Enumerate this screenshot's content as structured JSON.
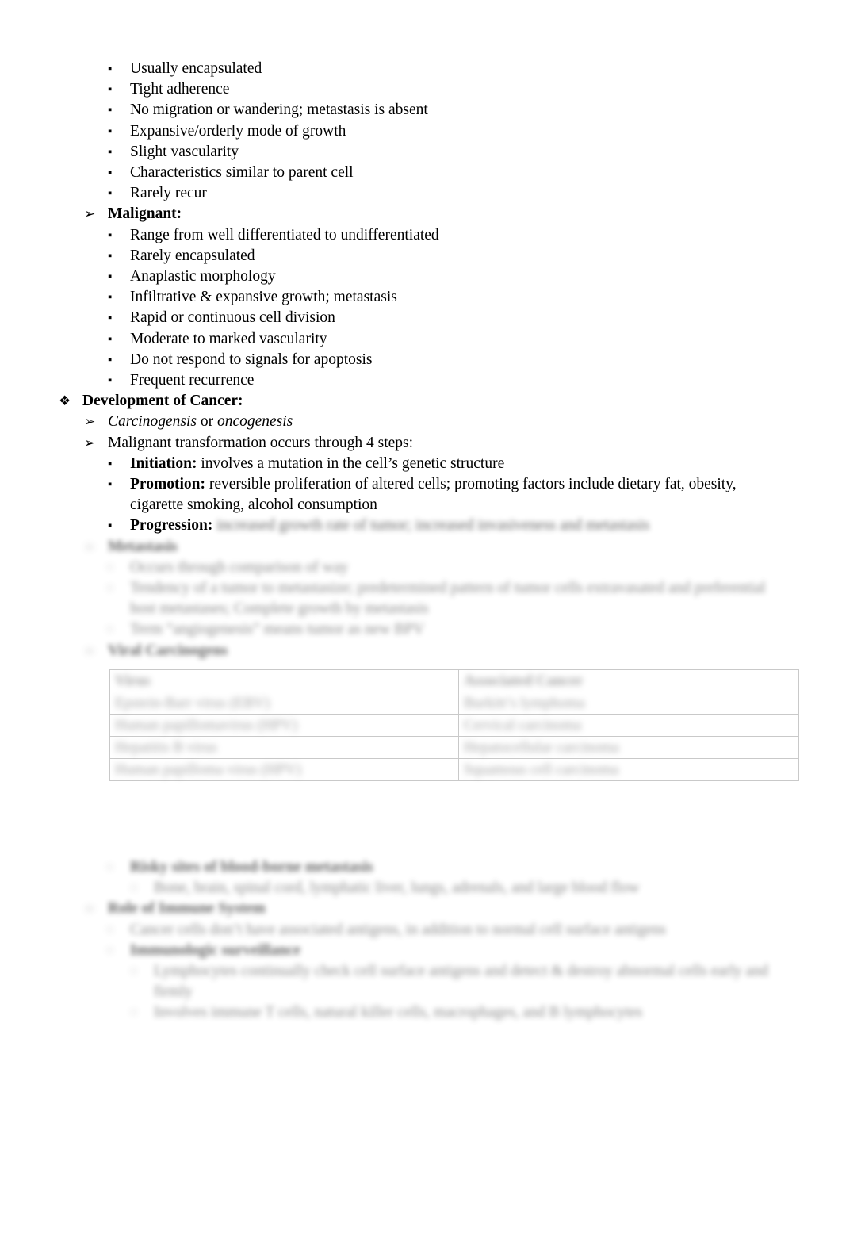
{
  "document": {
    "title": "Neoplasms and Development of Cancer outline",
    "page_background": "#ffffff",
    "text_color": "#000000"
  },
  "bullets": {
    "level1": "❖",
    "level2": "➢",
    "level3": "▪",
    "level4": "▪"
  },
  "benign_characteristics": [
    "Usually encapsulated",
    "Tight adherence",
    "No migration or wandering; metastasis is absent",
    "Expansive/orderly mode of growth",
    "Slight vascularity",
    "Characteristics similar to parent cell",
    "Rarely recur"
  ],
  "malignant": {
    "heading": "Malignant:",
    "items": [
      "Range from well differentiated to undifferentiated",
      "Rarely encapsulated",
      "Anaplastic morphology",
      "Infiltrative & expansive growth; metastasis",
      "Rapid or continuous cell division",
      "Moderate to marked vascularity",
      "Do not respond to signals for apoptosis",
      "Frequent recurrence"
    ]
  },
  "development_of_cancer": {
    "heading": "Development of Cancer:",
    "sub1_a": "Carcinogensis",
    "sub1_or": " or ",
    "sub1_b": "oncogenesis",
    "sub2": "Malignant transformation occurs through 4 steps:",
    "steps": [
      {
        "label": "Initiation:",
        "text": " involves a mutation in the cell’s genetic structure",
        "blurred": false
      },
      {
        "label": "Promotion:",
        "text": " reversible proliferation of altered cells; promoting factors include dietary fat, obesity, cigarette smoking, alcohol consumption",
        "blurred": false
      },
      {
        "label": "Progression:",
        "text": " increased growth rate of tumor; increased invasiveness and metastasis",
        "blurred": true
      }
    ]
  },
  "blurred_sections": [
    {
      "level": 2,
      "label": "Metastasis",
      "bold": true,
      "lines": []
    },
    {
      "level": 3,
      "label": "",
      "text": "Occurs through comparison of way",
      "bold": false
    },
    {
      "level": 3,
      "label": "",
      "text": "Tendency of a tumor to metastasize; predetermined pattern of tumor cells extravasated and preferential host metastases; Complete growth by metastasis",
      "bold": false
    },
    {
      "level": 3,
      "label": "",
      "text": "Term “angiogenesis” means tumor as new BPV",
      "bold": false
    },
    {
      "level": 2,
      "label": "Viral Carcinogens",
      "bold": true,
      "text": ""
    }
  ],
  "table": {
    "columns": [
      "Virus",
      "Associated Cancer"
    ],
    "rows": [
      [
        "Epstein-Barr virus (EBV)",
        "Burkitt’s lymphoma"
      ],
      [
        "Human papillomavirus (HPV)",
        "Cervical carcinoma"
      ],
      [
        "Hepatitis B virus",
        "Hepatocellular carcinoma"
      ],
      [
        "Human papilloma virus (HPV)",
        "Squamous cell carcinoma"
      ]
    ]
  },
  "lower_blurred_sections": [
    {
      "level": 3,
      "label": "Risky sites of blood-borne metastasis",
      "bold": true
    },
    {
      "level": 4,
      "text": "Bone, brain, spinal cord, lymphatic liver, lungs, adrenals, and large blood flow",
      "bold": false
    },
    {
      "level": 2,
      "label": "Role of Immune System",
      "bold": true
    },
    {
      "level": 3,
      "text": "Cancer cells don’t have associated antigens, in addition to normal cell surface antigens",
      "bold": false
    },
    {
      "level": 3,
      "label": "Immunologic surveillance",
      "bold": true
    },
    {
      "level": 4,
      "text": "Lymphocytes continually check cell surface antigens and detect & destroy abnormal cells early and firmly",
      "bold": false
    },
    {
      "level": 4,
      "text": "Involves immune T cells, natural killer cells, macrophages, and B lymphocytes",
      "bold": false
    }
  ]
}
